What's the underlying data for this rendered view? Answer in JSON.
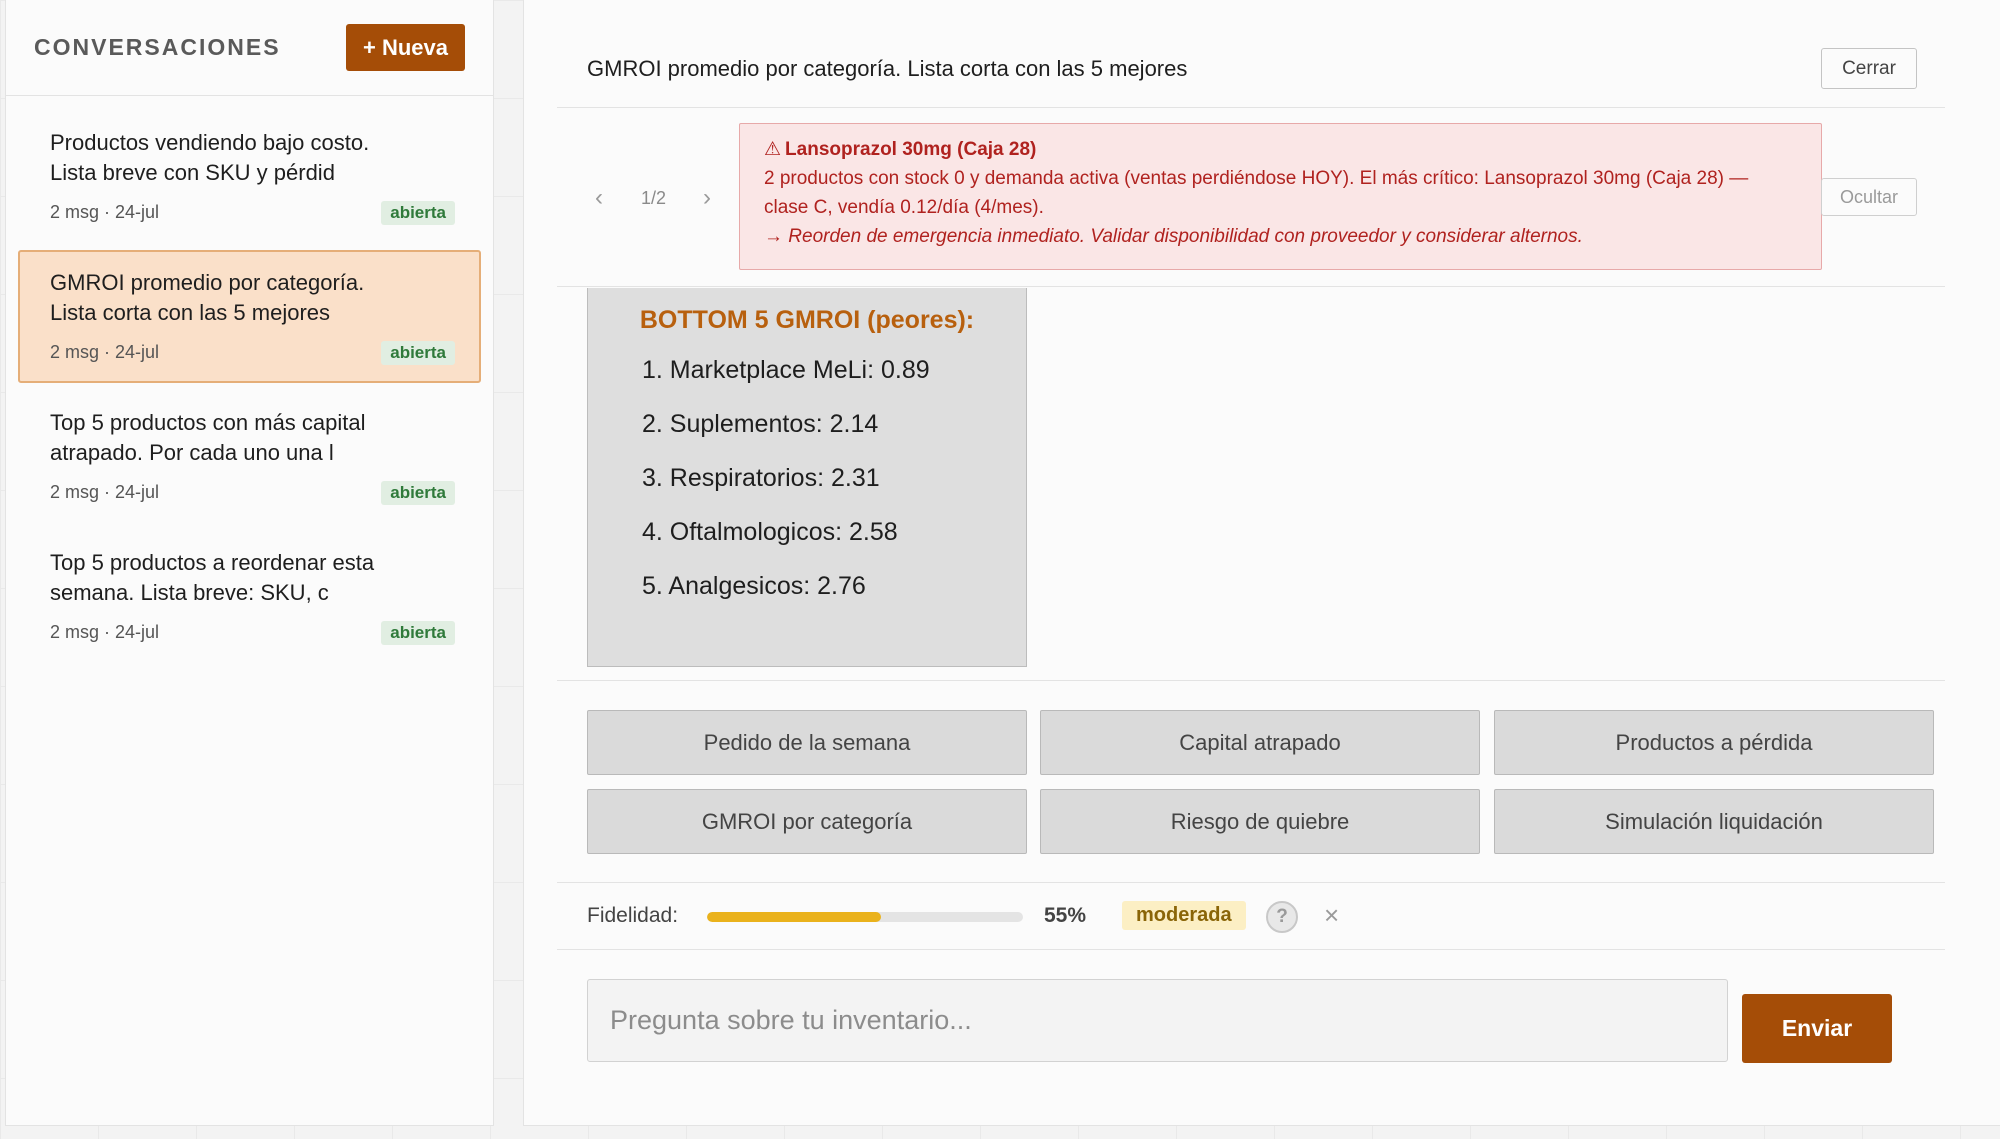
{
  "sidebar": {
    "title": "CONVERSACIONES",
    "new_button": "+ Nueva",
    "items": [
      {
        "title": "Productos vendiendo bajo costo. Lista breve con SKU y pérdid",
        "meta": "2 msg · 24-jul",
        "badge": "abierta",
        "active": false
      },
      {
        "title": "GMROI promedio por categoría. Lista corta con las 5 mejores",
        "meta": "2 msg · 24-jul",
        "badge": "abierta",
        "active": true
      },
      {
        "title": "Top 5 productos con más capital atrapado. Por cada uno una l",
        "meta": "2 msg · 24-jul",
        "badge": "abierta",
        "active": false
      },
      {
        "title": "Top 5 productos a reordenar esta semana. Lista breve: SKU, c",
        "meta": "2 msg · 24-jul",
        "badge": "abierta",
        "active": false
      }
    ]
  },
  "header": {
    "title": "GMROI promedio por categoría. Lista corta con las 5 mejores",
    "close_label": "Cerrar"
  },
  "alert": {
    "pager": {
      "prev_icon": "‹",
      "count": "1/2",
      "next_icon": "›"
    },
    "icon": "⚠",
    "title": "Lansoprazol 30mg (Caja 28)",
    "body": "2 productos con stock 0 y demanda activa (ventas perdiéndose HOY). El más crítico: Lansoprazol 30mg (Caja 28) — clase C, vendía 0.12/día (4/mes).",
    "action": "→ Reorden de emergencia inmediato. Validar disponibilidad con proveedor y considerar alternos.",
    "hide_label": "Ocultar"
  },
  "result": {
    "heading": "BOTTOM 5 GMROI (peores):",
    "items": [
      "1. Marketplace MeLi: 0.89",
      "2. Suplementos: 2.14",
      "3. Respiratorios: 2.31",
      "4. Oftalmologicos: 2.58",
      "5. Analgesicos: 2.76"
    ]
  },
  "quick_actions": [
    "Pedido de la semana",
    "Capital atrapado",
    "Productos a pérdida",
    "GMROI por categoría",
    "Riesgo de quiebre",
    "Simulación liquidación"
  ],
  "fidelity": {
    "label": "Fidelidad:",
    "value": 55,
    "percent_text": "55%",
    "level": "moderada",
    "help_icon": "?",
    "dismiss_icon": "×",
    "color": "#eab21c"
  },
  "input": {
    "placeholder": "Pregunta sobre tu inventario...",
    "value": "",
    "send_label": "Enviar"
  },
  "colors": {
    "accent": "#a54d07",
    "active_item_bg": "#fae0c9",
    "alert_bg": "#fae6e6",
    "alert_text": "#b0221f",
    "badge_green": "#2f7a3a",
    "result_heading": "#b8600e"
  }
}
